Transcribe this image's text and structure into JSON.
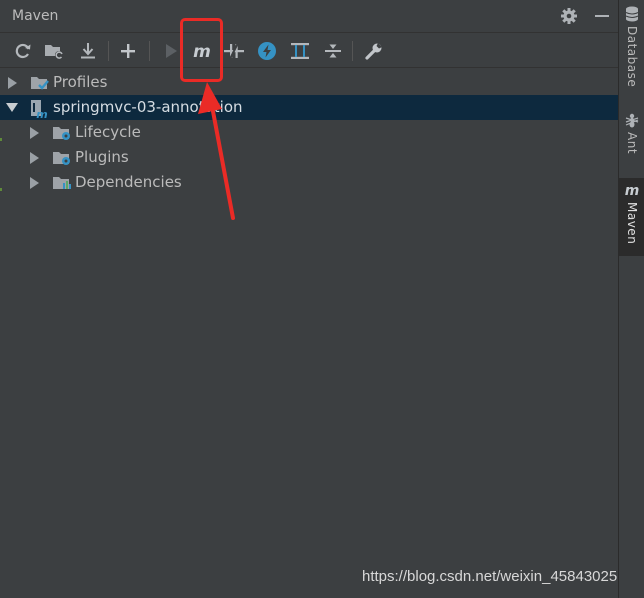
{
  "panel": {
    "title": "Maven"
  },
  "header": {
    "settings_icon": "gear-icon",
    "minimize_icon": "minimize-icon"
  },
  "toolbar": {
    "buttons": [
      {
        "name": "reload-all-projects-button",
        "icon": "refresh-icon"
      },
      {
        "name": "generate-sources-button",
        "icon": "folder-refresh-icon"
      },
      {
        "name": "download-sources-button",
        "icon": "download-icon"
      },
      {
        "name": "add-maven-project-button",
        "icon": "plus-icon"
      },
      {
        "name": "run-maven-build-button",
        "icon": "play-icon"
      },
      {
        "name": "execute-maven-goal-button",
        "icon": "maven-m-icon"
      },
      {
        "name": "toggle-offline-mode-button",
        "icon": "offline-icon"
      },
      {
        "name": "skip-tests-button",
        "icon": "lightning-icon"
      },
      {
        "name": "show-dependencies-button",
        "icon": "dependencies-diagram-icon"
      },
      {
        "name": "collapse-all-button",
        "icon": "collapse-all-icon"
      },
      {
        "name": "maven-settings-button",
        "icon": "wrench-icon"
      }
    ]
  },
  "tree": {
    "profiles": "Profiles",
    "project": "springmvc-03-annotation",
    "lifecycle": "Lifecycle",
    "plugins": "Plugins",
    "dependencies": "Dependencies"
  },
  "right_strip": {
    "database": "Database",
    "ant": "Ant",
    "maven": "Maven"
  },
  "colors": {
    "highlight": "#ea2b26",
    "selection": "#0d293e",
    "accent_blue": "#3592c4"
  },
  "watermark": "https://blog.csdn.net/weixin_45843025"
}
